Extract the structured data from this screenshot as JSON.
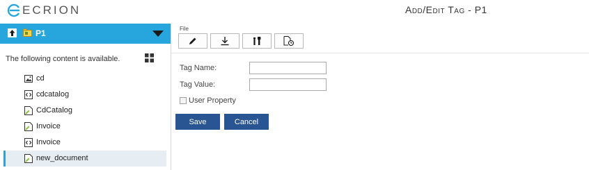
{
  "app": {
    "logo_text": "ECRION",
    "page_title": "Add/Edit Tag - P1"
  },
  "sidebar": {
    "project_name": "P1",
    "available_text": "The following content is available.",
    "items": [
      {
        "label": "cd",
        "icon": "image-icon",
        "selected": false
      },
      {
        "label": "cdcatalog",
        "icon": "code-file-icon",
        "selected": false
      },
      {
        "label": "CdCatalog",
        "icon": "document-icon",
        "selected": false
      },
      {
        "label": "Invoice",
        "icon": "document-icon",
        "selected": false
      },
      {
        "label": "Invoice",
        "icon": "code-file-icon",
        "selected": false
      },
      {
        "label": "new_document",
        "icon": "document-icon",
        "selected": true
      }
    ]
  },
  "toolbar": {
    "group_label": "File",
    "buttons": [
      {
        "icon": "pencil-icon"
      },
      {
        "icon": "download-icon"
      },
      {
        "icon": "tools-icon"
      },
      {
        "icon": "document-clock-icon"
      }
    ]
  },
  "form": {
    "tag_name_label": "Tag Name:",
    "tag_name_value": "",
    "tag_value_label": "Tag Value:",
    "tag_value_value": "",
    "user_property_label": "User Property",
    "user_property_checked": false,
    "save_label": "Save",
    "cancel_label": "Cancel"
  },
  "colors": {
    "accent": "#27a5dd",
    "button": "#2a5593",
    "selected_row": "#e6eef4"
  }
}
